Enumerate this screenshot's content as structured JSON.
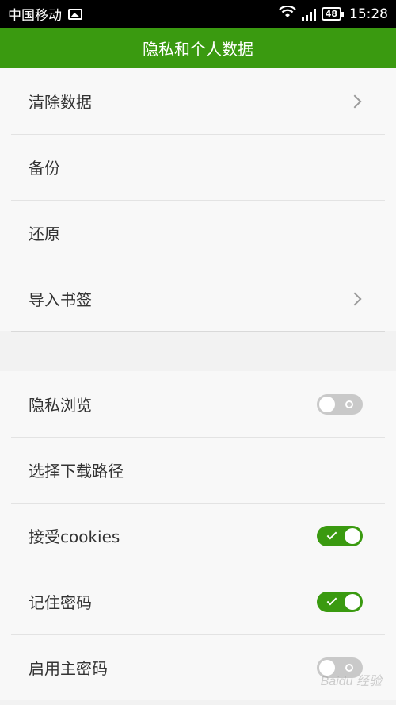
{
  "status_bar": {
    "carrier": "中国移动",
    "battery": "48",
    "time": "15:28"
  },
  "title": "隐私和个人数据",
  "group1": [
    {
      "label": "清除数据",
      "control": "chevron"
    },
    {
      "label": "备份",
      "control": "none"
    },
    {
      "label": "还原",
      "control": "none"
    },
    {
      "label": "导入书签",
      "control": "chevron"
    }
  ],
  "group2": [
    {
      "label": "隐私浏览",
      "control": "toggle",
      "state": "off"
    },
    {
      "label": "选择下载路径",
      "control": "none"
    },
    {
      "label": "接受cookies",
      "control": "toggle",
      "state": "on"
    },
    {
      "label": "记住密码",
      "control": "toggle",
      "state": "on"
    },
    {
      "label": "启用主密码",
      "control": "toggle",
      "state": "off"
    }
  ],
  "colors": {
    "accent": "#3a9a10",
    "toggle_off": "#c9c9c9"
  },
  "watermark": "Baidu 经验"
}
